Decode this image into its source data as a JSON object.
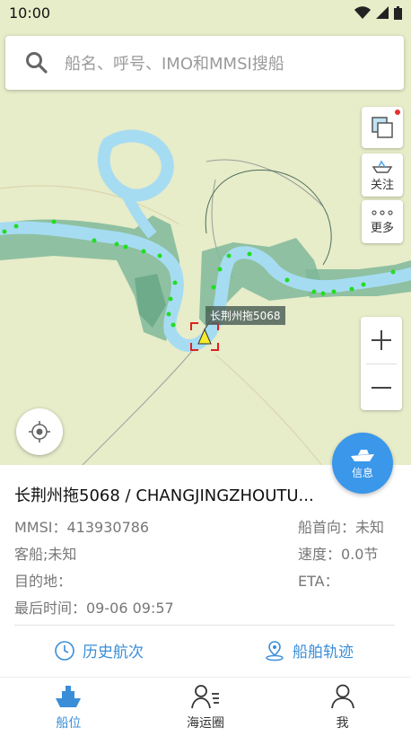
{
  "status_bar": {
    "time": "10:00"
  },
  "search": {
    "placeholder": "船名、呼号、IMO和MMSI搜船"
  },
  "map": {
    "ship_label": "长荆州拖5068",
    "buttons": {
      "follow_label": "关注",
      "more_label": "更多"
    },
    "info_button_label": "信息"
  },
  "ship": {
    "title": "长荆州拖5068 / CHANGJINGZHOUTU...",
    "mmsi": "MMSI：413930786",
    "type": "客船;未知",
    "destination": "目的地：",
    "last_time": "最后时间：09-06 09:57",
    "heading": "船首向：未知",
    "speed": "速度：0.0节",
    "eta": "ETA："
  },
  "actions": {
    "history": "历史航次",
    "track": "船舶轨迹"
  },
  "tabs": [
    {
      "label": "船位"
    },
    {
      "label": "海运圈"
    },
    {
      "label": "我"
    }
  ],
  "colors": {
    "accent": "#3a8ed8",
    "fab": "#3a97ea",
    "map_land": "#e7ecc9",
    "river": "#a6dcf2",
    "wetland": "#7fb89a",
    "ship_dot": "#22dd22"
  }
}
